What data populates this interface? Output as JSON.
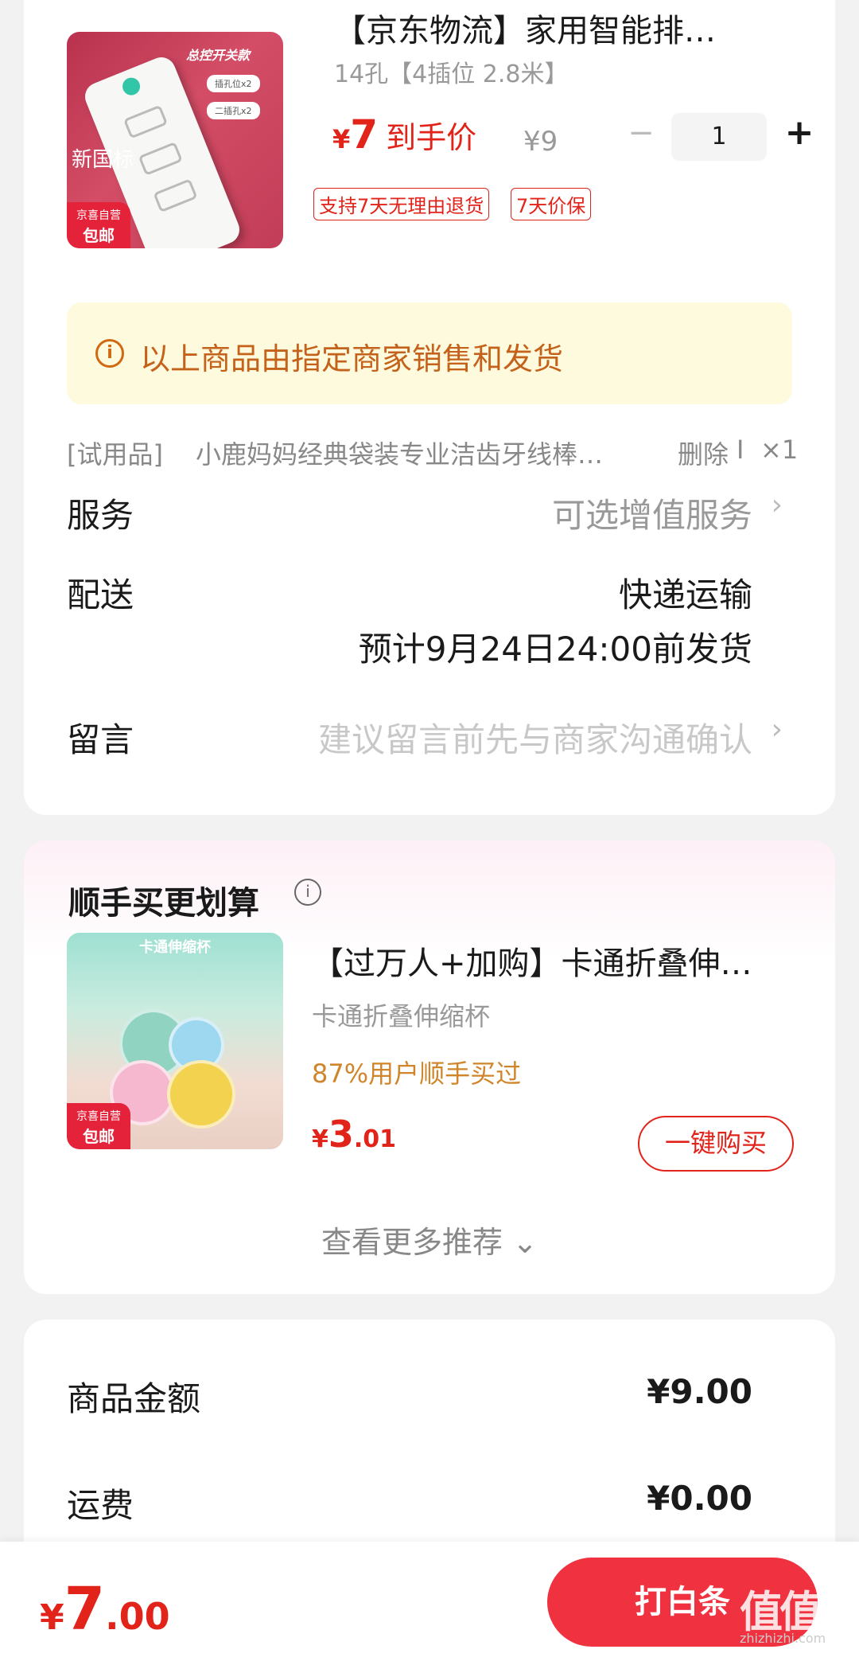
{
  "product": {
    "title": "【京东物流】家用智能排…",
    "spec": "14孔【4插位 2.8米】",
    "price_currency": "¥",
    "price": "7",
    "price_label": "到手价",
    "original_price": "¥9",
    "quantity": "1",
    "minus": "−",
    "plus": "+",
    "tags": [
      "支持7天无理由退货",
      "7天价保"
    ],
    "image_text": {
      "top": "总控开关款",
      "pill1": "插孔位x2",
      "pill2": "二插孔x2",
      "standard": "新国标",
      "badge_top": "京喜自营",
      "badge_bottom": "包邮"
    }
  },
  "notice": {
    "icon": "info-icon",
    "icon_glyph": "i",
    "text": "以上商品由指定商家销售和发货"
  },
  "trial_item": {
    "label": "[试用品]",
    "name": "小鹿妈妈经典袋装专业洁齿牙线棒…",
    "delete": "删除",
    "separator": "I",
    "count": "×1"
  },
  "service": {
    "label": "服务",
    "value": "可选增值服务"
  },
  "shipping": {
    "label": "配送",
    "method": "快递运输",
    "eta": "预计9月24日24:00前发货"
  },
  "message": {
    "label": "留言",
    "placeholder": "建议留言前先与商家沟通确认"
  },
  "chevron": "›",
  "recommend": {
    "title": "顺手买更划算",
    "info_glyph": "i",
    "item": {
      "title": "【过万人+加购】卡通折叠伸…",
      "subtitle": "卡通折叠伸缩杯",
      "social_proof": "87%用户顺手买过",
      "price_currency": "¥",
      "price_int": "3",
      "price_dec": ".01",
      "buy_label": "一键购买",
      "image_title": "卡通伸缩杯",
      "badge_top": "京喜自营",
      "badge_bottom": "包邮"
    },
    "more_label": "查看更多推荐 ⌄"
  },
  "summary": {
    "goods_label": "商品金额",
    "goods_value": "¥9.00",
    "freight_label": "运费",
    "freight_value": "¥0.00"
  },
  "bottom": {
    "total_currency": "¥",
    "total_int": "7",
    "total_dec": ".00",
    "pay_label": "打白条",
    "watermark": "值值值",
    "watermark_url": "zhizhizhi.com"
  },
  "colors": {
    "accent_red": "#e2231a",
    "pay_button": "#f0313f",
    "notice_bg": "#fefadd",
    "notice_text": "#c4621b"
  }
}
